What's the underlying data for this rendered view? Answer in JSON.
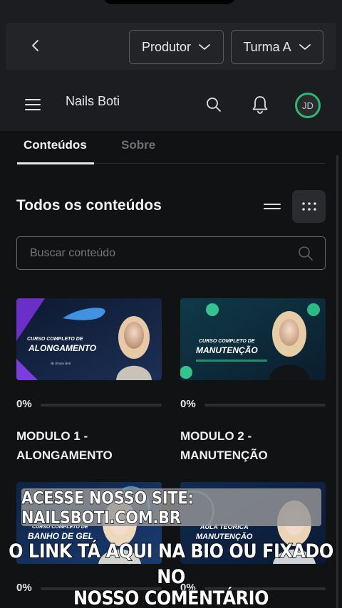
{
  "topbar": {
    "producer_label": "Produtor",
    "class_label": "Turma A"
  },
  "header": {
    "brand": "Nails Boti",
    "avatar_initials": "JD"
  },
  "tabs": [
    {
      "label": "Conteúdos",
      "active": true
    },
    {
      "label": "Sobre",
      "active": false
    }
  ],
  "section": {
    "title": "Todos os conteúdos",
    "search_placeholder": "Buscar conteúdo"
  },
  "cards": [
    {
      "thumb_line1": "CURSO COMPLETO DE",
      "thumb_line2": "ALONGAMENTO",
      "thumb_sig": "By Bruna Boti",
      "progress_text": "0%",
      "progress": 0,
      "title_line1": "MODULO 1 -",
      "title_line2": "ALONGAMENTO"
    },
    {
      "thumb_line1": "CURSO COMPLETO DE",
      "thumb_line2": "MANUTENÇÃO",
      "progress_text": "0%",
      "progress": 0,
      "title_line1": "MODULO 2 -",
      "title_line2": "MANUTENÇÃO"
    },
    {
      "thumb_line1": "CURSO COMPLETO DE",
      "thumb_line2": "BANHO DE GEL",
      "progress_text": "0%",
      "progress": 0
    },
    {
      "thumb_line1": "AULA TEORICA",
      "thumb_line2": "MANUTENÇÃO",
      "progress_text": "0%",
      "progress": 0
    }
  ],
  "overlay": {
    "banner": "ACESSE NOSSO SITE: NAILSBOTI.COM.BR",
    "caption_line1": "O LINK TÁ AQUI NA BIO OU FIXADO NO",
    "caption_line2": "NOSSO COMENTÁRIO"
  },
  "colors": {
    "accent": "#2eb872",
    "background": "#111214",
    "header_bg": "#1c1d20"
  }
}
